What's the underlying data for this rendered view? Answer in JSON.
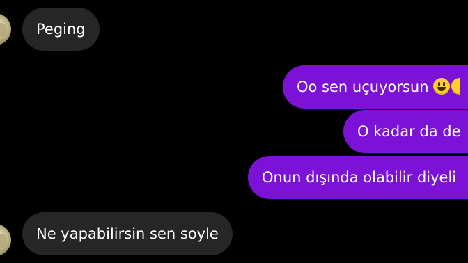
{
  "messages": [
    {
      "id": "m1",
      "direction": "incoming",
      "text": "Peging"
    },
    {
      "id": "m2",
      "direction": "outgoing",
      "text": "Oo sen uçuyorsun",
      "emoji": "grinning-face-emoji"
    },
    {
      "id": "m3",
      "direction": "outgoing",
      "text": "O kadar da de"
    },
    {
      "id": "m4",
      "direction": "outgoing",
      "text": "Onun dışında olabilir diyeli"
    },
    {
      "id": "m5",
      "direction": "incoming",
      "text": "Ne yapabilirsin sen soyle"
    }
  ],
  "colors": {
    "background": "#000000",
    "incoming_bubble": "#262626",
    "outgoing_bubble": "#7b12d6",
    "text": "#ffffff"
  }
}
